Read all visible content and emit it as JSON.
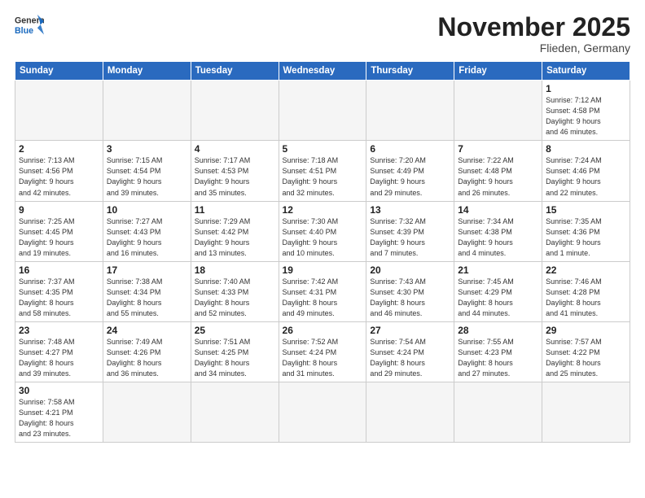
{
  "header": {
    "logo_general": "General",
    "logo_blue": "Blue",
    "month_title": "November 2025",
    "location": "Flieden, Germany"
  },
  "weekdays": [
    "Sunday",
    "Monday",
    "Tuesday",
    "Wednesday",
    "Thursday",
    "Friday",
    "Saturday"
  ],
  "days": [
    {
      "num": "",
      "info": ""
    },
    {
      "num": "",
      "info": ""
    },
    {
      "num": "",
      "info": ""
    },
    {
      "num": "",
      "info": ""
    },
    {
      "num": "",
      "info": ""
    },
    {
      "num": "",
      "info": ""
    },
    {
      "num": "1",
      "info": "Sunrise: 7:12 AM\nSunset: 4:58 PM\nDaylight: 9 hours\nand 46 minutes."
    },
    {
      "num": "2",
      "info": "Sunrise: 7:13 AM\nSunset: 4:56 PM\nDaylight: 9 hours\nand 42 minutes."
    },
    {
      "num": "3",
      "info": "Sunrise: 7:15 AM\nSunset: 4:54 PM\nDaylight: 9 hours\nand 39 minutes."
    },
    {
      "num": "4",
      "info": "Sunrise: 7:17 AM\nSunset: 4:53 PM\nDaylight: 9 hours\nand 35 minutes."
    },
    {
      "num": "5",
      "info": "Sunrise: 7:18 AM\nSunset: 4:51 PM\nDaylight: 9 hours\nand 32 minutes."
    },
    {
      "num": "6",
      "info": "Sunrise: 7:20 AM\nSunset: 4:49 PM\nDaylight: 9 hours\nand 29 minutes."
    },
    {
      "num": "7",
      "info": "Sunrise: 7:22 AM\nSunset: 4:48 PM\nDaylight: 9 hours\nand 26 minutes."
    },
    {
      "num": "8",
      "info": "Sunrise: 7:24 AM\nSunset: 4:46 PM\nDaylight: 9 hours\nand 22 minutes."
    },
    {
      "num": "9",
      "info": "Sunrise: 7:25 AM\nSunset: 4:45 PM\nDaylight: 9 hours\nand 19 minutes."
    },
    {
      "num": "10",
      "info": "Sunrise: 7:27 AM\nSunset: 4:43 PM\nDaylight: 9 hours\nand 16 minutes."
    },
    {
      "num": "11",
      "info": "Sunrise: 7:29 AM\nSunset: 4:42 PM\nDaylight: 9 hours\nand 13 minutes."
    },
    {
      "num": "12",
      "info": "Sunrise: 7:30 AM\nSunset: 4:40 PM\nDaylight: 9 hours\nand 10 minutes."
    },
    {
      "num": "13",
      "info": "Sunrise: 7:32 AM\nSunset: 4:39 PM\nDaylight: 9 hours\nand 7 minutes."
    },
    {
      "num": "14",
      "info": "Sunrise: 7:34 AM\nSunset: 4:38 PM\nDaylight: 9 hours\nand 4 minutes."
    },
    {
      "num": "15",
      "info": "Sunrise: 7:35 AM\nSunset: 4:36 PM\nDaylight: 9 hours\nand 1 minute."
    },
    {
      "num": "16",
      "info": "Sunrise: 7:37 AM\nSunset: 4:35 PM\nDaylight: 8 hours\nand 58 minutes."
    },
    {
      "num": "17",
      "info": "Sunrise: 7:38 AM\nSunset: 4:34 PM\nDaylight: 8 hours\nand 55 minutes."
    },
    {
      "num": "18",
      "info": "Sunrise: 7:40 AM\nSunset: 4:33 PM\nDaylight: 8 hours\nand 52 minutes."
    },
    {
      "num": "19",
      "info": "Sunrise: 7:42 AM\nSunset: 4:31 PM\nDaylight: 8 hours\nand 49 minutes."
    },
    {
      "num": "20",
      "info": "Sunrise: 7:43 AM\nSunset: 4:30 PM\nDaylight: 8 hours\nand 46 minutes."
    },
    {
      "num": "21",
      "info": "Sunrise: 7:45 AM\nSunset: 4:29 PM\nDaylight: 8 hours\nand 44 minutes."
    },
    {
      "num": "22",
      "info": "Sunrise: 7:46 AM\nSunset: 4:28 PM\nDaylight: 8 hours\nand 41 minutes."
    },
    {
      "num": "23",
      "info": "Sunrise: 7:48 AM\nSunset: 4:27 PM\nDaylight: 8 hours\nand 39 minutes."
    },
    {
      "num": "24",
      "info": "Sunrise: 7:49 AM\nSunset: 4:26 PM\nDaylight: 8 hours\nand 36 minutes."
    },
    {
      "num": "25",
      "info": "Sunrise: 7:51 AM\nSunset: 4:25 PM\nDaylight: 8 hours\nand 34 minutes."
    },
    {
      "num": "26",
      "info": "Sunrise: 7:52 AM\nSunset: 4:24 PM\nDaylight: 8 hours\nand 31 minutes."
    },
    {
      "num": "27",
      "info": "Sunrise: 7:54 AM\nSunset: 4:24 PM\nDaylight: 8 hours\nand 29 minutes."
    },
    {
      "num": "28",
      "info": "Sunrise: 7:55 AM\nSunset: 4:23 PM\nDaylight: 8 hours\nand 27 minutes."
    },
    {
      "num": "29",
      "info": "Sunrise: 7:57 AM\nSunset: 4:22 PM\nDaylight: 8 hours\nand 25 minutes."
    },
    {
      "num": "30",
      "info": "Sunrise: 7:58 AM\nSunset: 4:21 PM\nDaylight: 8 hours\nand 23 minutes."
    }
  ]
}
